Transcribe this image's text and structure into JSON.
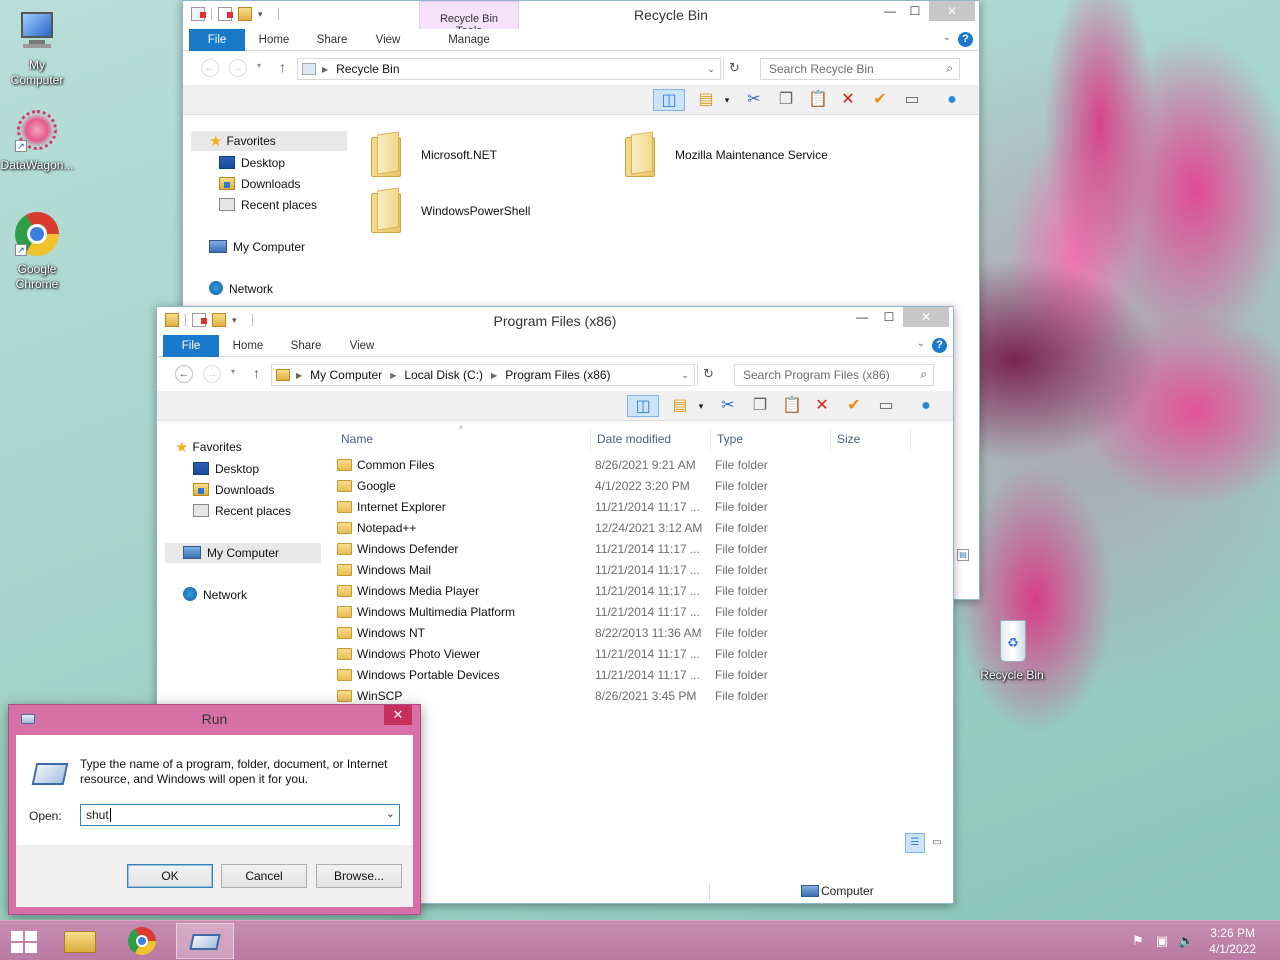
{
  "desktop": {
    "icons": [
      {
        "label": "My\nComputer"
      },
      {
        "label": "DataWagon..."
      },
      {
        "label": "Google\nChrome"
      },
      {
        "label": "Recycle Bin"
      }
    ]
  },
  "recycle_window": {
    "title": "Recycle Bin",
    "context_tab": "Recycle Bin Tools",
    "ribbon_tabs": [
      "File",
      "Home",
      "Share",
      "View",
      "Manage"
    ],
    "address": [
      "Recycle Bin"
    ],
    "search_placeholder": "Search Recycle Bin",
    "nav": [
      "Favorites",
      "Desktop",
      "Downloads",
      "Recent places",
      "My Computer",
      "Network"
    ],
    "items": [
      "Microsoft.NET",
      "Mozilla Maintenance Service",
      "WindowsPowerShell"
    ]
  },
  "program_window": {
    "title": "Program Files (x86)",
    "ribbon_tabs": [
      "File",
      "Home",
      "Share",
      "View"
    ],
    "address": [
      "My Computer",
      "Local Disk (C:)",
      "Program Files (x86)"
    ],
    "search_placeholder": "Search Program Files (x86)",
    "nav": [
      "Favorites",
      "Desktop",
      "Downloads",
      "Recent places",
      "My Computer",
      "Network"
    ],
    "columns": [
      "Name",
      "Date modified",
      "Type",
      "Size"
    ],
    "rows": [
      {
        "name": "Common Files",
        "date": "8/26/2021 9:21 AM",
        "type": "File folder"
      },
      {
        "name": "Google",
        "date": "4/1/2022 3:20 PM",
        "type": "File folder"
      },
      {
        "name": "Internet Explorer",
        "date": "11/21/2014 11:17 ...",
        "type": "File folder"
      },
      {
        "name": "Notepad++",
        "date": "12/24/2021 3:12 AM",
        "type": "File folder"
      },
      {
        "name": "Windows Defender",
        "date": "11/21/2014 11:17 ...",
        "type": "File folder"
      },
      {
        "name": "Windows Mail",
        "date": "11/21/2014 11:17 ...",
        "type": "File folder"
      },
      {
        "name": "Windows Media Player",
        "date": "11/21/2014 11:17 ...",
        "type": "File folder"
      },
      {
        "name": "Windows Multimedia Platform",
        "date": "11/21/2014 11:17 ...",
        "type": "File folder"
      },
      {
        "name": "Windows NT",
        "date": "8/22/2013 11:36 AM",
        "type": "File folder"
      },
      {
        "name": "Windows Photo Viewer",
        "date": "11/21/2014 11:17 ...",
        "type": "File folder"
      },
      {
        "name": "Windows Portable Devices",
        "date": "11/21/2014 11:17 ...",
        "type": "File folder"
      },
      {
        "name": "WinSCP",
        "date": "8/26/2021 3:45 PM",
        "type": "File folder"
      }
    ],
    "status_location": "Computer"
  },
  "run_dialog": {
    "title": "Run",
    "description": "Type the name of a program, folder, document, or Internet resource, and Windows will open it for you.",
    "open_label": "Open:",
    "open_value": "shut",
    "ok_label": "OK",
    "cancel_label": "Cancel",
    "browse_label": "Browse..."
  },
  "taskbar": {
    "time": "3:26 PM",
    "date": "4/1/2022"
  }
}
